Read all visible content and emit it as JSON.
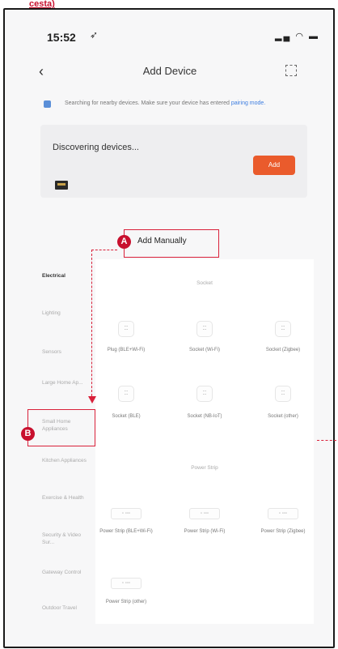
{
  "header": {
    "text": "cesta)"
  },
  "status_bar": {
    "time": "15:52",
    "location_icon": "location-arrow-icon",
    "icons": "signal wifi battery"
  },
  "nav": {
    "title": "Add Device",
    "back_icon": "chevron-left-icon",
    "scan_icon": "scan-icon"
  },
  "hint": {
    "text": "Searching for nearby devices. Make sure your device has entered",
    "link": "pairing mode."
  },
  "discovering": {
    "title": "Discovering devices...",
    "button_label": "Add"
  },
  "callouts": {
    "a": "A",
    "b": "B",
    "add_manually": "Add Manually"
  },
  "sidebar": {
    "items": [
      {
        "label": "Electrical",
        "active": true
      },
      {
        "label": "Lighting",
        "active": false
      },
      {
        "label": "Sensors",
        "active": false
      },
      {
        "label": "Large Home Ap...",
        "active": false
      },
      {
        "label": "Small Home Appliances",
        "active": false
      },
      {
        "label": "Kitchen Appliances",
        "active": false
      },
      {
        "label": "Exercise & Health",
        "active": false
      },
      {
        "label": "Security & Video Sur...",
        "active": false
      },
      {
        "label": "Gateway Control",
        "active": false
      },
      {
        "label": "Outdoor Travel",
        "active": false
      }
    ]
  },
  "sections": [
    {
      "title": "Socket",
      "items": [
        {
          "label": "Plug (BLE+Wi-Fi)"
        },
        {
          "label": "Socket (Wi-Fi)"
        },
        {
          "label": "Socket (Zigbee)"
        },
        {
          "label": "Socket (BLE)"
        },
        {
          "label": "Socket (NB-IoT)"
        },
        {
          "label": "Socket (other)"
        }
      ]
    },
    {
      "title": "Power Strip",
      "items": [
        {
          "label": "Power Strip (BLE+Wi-Fi)"
        },
        {
          "label": "Power Strip (Wi-Fi)"
        },
        {
          "label": "Power Strip (Zigbee)"
        },
        {
          "label": "Power Strip (other)"
        }
      ]
    }
  ],
  "colors": {
    "accent": "#ea5b2c",
    "callout": "#d9213a",
    "link": "#3d7de0"
  }
}
